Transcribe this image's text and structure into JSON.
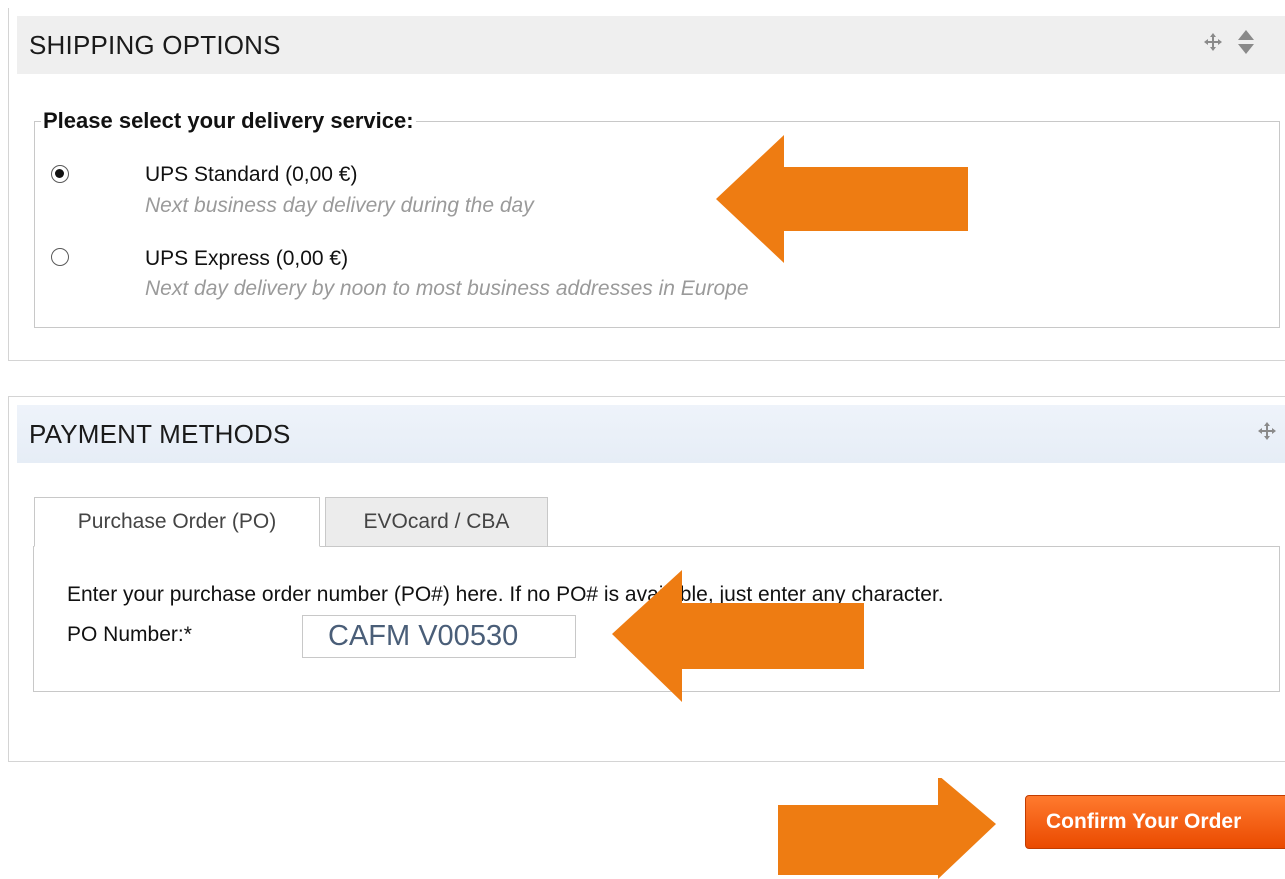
{
  "shipping": {
    "title": "SHIPPING OPTIONS",
    "legend": "Please select your delivery service:",
    "options": [
      {
        "label": "UPS Standard (0,00 €)",
        "description": "Next business day delivery during the day",
        "selected": true
      },
      {
        "label": "UPS Express (0,00 €)",
        "description": "Next day delivery by noon to most business addresses in Europe",
        "selected": false
      }
    ],
    "icons": [
      "move-icon",
      "collapse-icon"
    ]
  },
  "payment": {
    "title": "PAYMENT METHODS",
    "tabs": [
      "Purchase Order (PO)",
      "EVOcard / CBA"
    ],
    "active_tab": "Purchase Order (PO)",
    "instructions": "Enter your purchase order number (PO#) here. If no PO# is available, just enter any character.",
    "po_label": "PO Number:*",
    "po_value": "CAFM V00530",
    "icons": [
      "move-icon"
    ]
  },
  "confirm_button": "Confirm Your Order",
  "colors": {
    "accent_orange": "#ee7c12",
    "button_orange": "#f05a10",
    "header_gray": "#efefef",
    "header_blue": "#e9eff8"
  }
}
